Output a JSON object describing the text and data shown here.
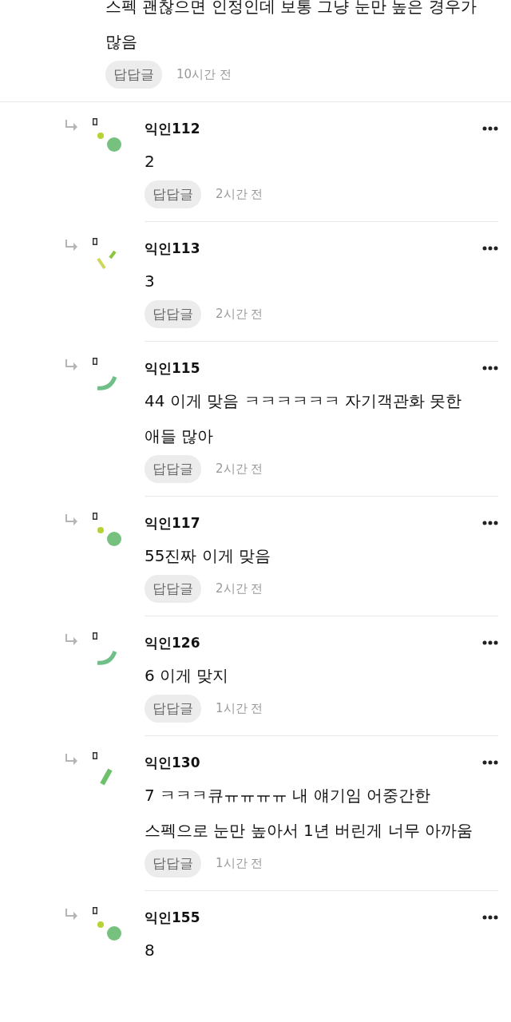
{
  "parent": {
    "body": "스펙 괜찮으면 인정인데 보통 그냥 눈만 높은 경우가 많음",
    "reply_label": "답답글",
    "time": "10시간 전"
  },
  "comments": [
    {
      "kind": "dots",
      "name": "익인112",
      "body": "2",
      "reply_label": "답답글",
      "time": "2시간 전"
    },
    {
      "kind": "dashes",
      "name": "익인113",
      "body": "3",
      "reply_label": "답답글",
      "time": "2시간 전"
    },
    {
      "kind": "arc",
      "name": "익인115",
      "body": "44 이게 맞음 ㅋㅋㅋㅋㅋㅋ 자기객관화 못한 애들 많아",
      "reply_label": "답답글",
      "time": "2시간 전"
    },
    {
      "kind": "dots",
      "name": "익인117",
      "body": "55진짜 이게 맞음",
      "reply_label": "답답글",
      "time": "2시간 전"
    },
    {
      "kind": "arc",
      "name": "익인126",
      "body": "6 이게 맞지",
      "reply_label": "답답글",
      "time": "1시간 전"
    },
    {
      "kind": "bar",
      "name": "익인130",
      "body": "7 ㅋㅋㅋ큐ㅠㅠㅠㅠ 내 얘기임 어중간한 스펙으로 눈만 높아서 1년 버린게 너무 아까움",
      "reply_label": "답답글",
      "time": "1시간 전"
    },
    {
      "kind": "dots",
      "name": "익인155",
      "body": "8"
    }
  ]
}
